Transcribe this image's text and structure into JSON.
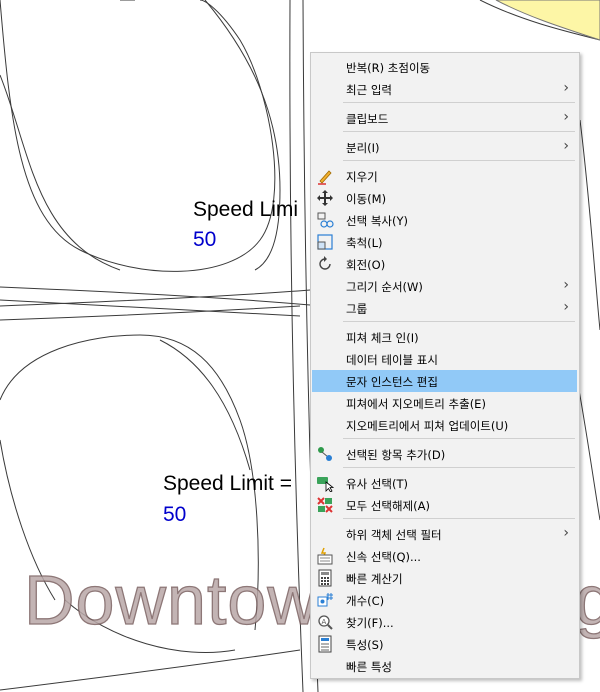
{
  "map": {
    "labels": [
      {
        "text": "Speed Limi",
        "value": "50"
      },
      {
        "text": "Speed Limit =",
        "value": "50"
      }
    ],
    "watermark": "Downtown",
    "watermark_tail": "g"
  },
  "menu": {
    "items": [
      {
        "label": "반복(R) 초점이동"
      },
      {
        "label": "최근 입력",
        "submenu": "›"
      },
      {
        "label": "클립보드",
        "submenu": "›"
      },
      {
        "label": "분리(I)",
        "submenu": "›"
      },
      {
        "label": "지우기",
        "icon": "eraser-icon"
      },
      {
        "label": "이동(M)",
        "icon": "move-icon"
      },
      {
        "label": "선택 복사(Y)",
        "icon": "copy-icon"
      },
      {
        "label": "축척(L)",
        "icon": "scale-icon"
      },
      {
        "label": "회전(O)",
        "icon": "rotate-icon"
      },
      {
        "label": "그리기 순서(W)",
        "submenu": "›"
      },
      {
        "label": "그룹",
        "submenu": "›"
      },
      {
        "label": "피쳐 체크 인(I)"
      },
      {
        "label": "데이터 테이블 표시"
      },
      {
        "label": "문자 인스턴스 편집",
        "highlighted": true
      },
      {
        "label": "피쳐에서 지오메트리 추출(E)"
      },
      {
        "label": "지오메트리에서 피쳐 업데이트(U)"
      },
      {
        "label": "선택된 항목 추가(D)",
        "icon": "add-selected-icon"
      },
      {
        "label": "유사 선택(T)",
        "icon": "select-similar-icon"
      },
      {
        "label": "모두 선택해제(A)",
        "icon": "deselect-all-icon"
      },
      {
        "label": "하위 객체 선택 필터",
        "submenu": "›"
      },
      {
        "label": "신속 선택(Q)...",
        "icon": "quick-select-icon"
      },
      {
        "label": "빠른 계산기",
        "icon": "calculator-icon"
      },
      {
        "label": "개수(C)",
        "icon": "count-icon"
      },
      {
        "label": "찾기(F)...",
        "icon": "find-icon"
      },
      {
        "label": "특성(S)",
        "icon": "properties-icon"
      },
      {
        "label": "빠른 특성"
      }
    ]
  }
}
